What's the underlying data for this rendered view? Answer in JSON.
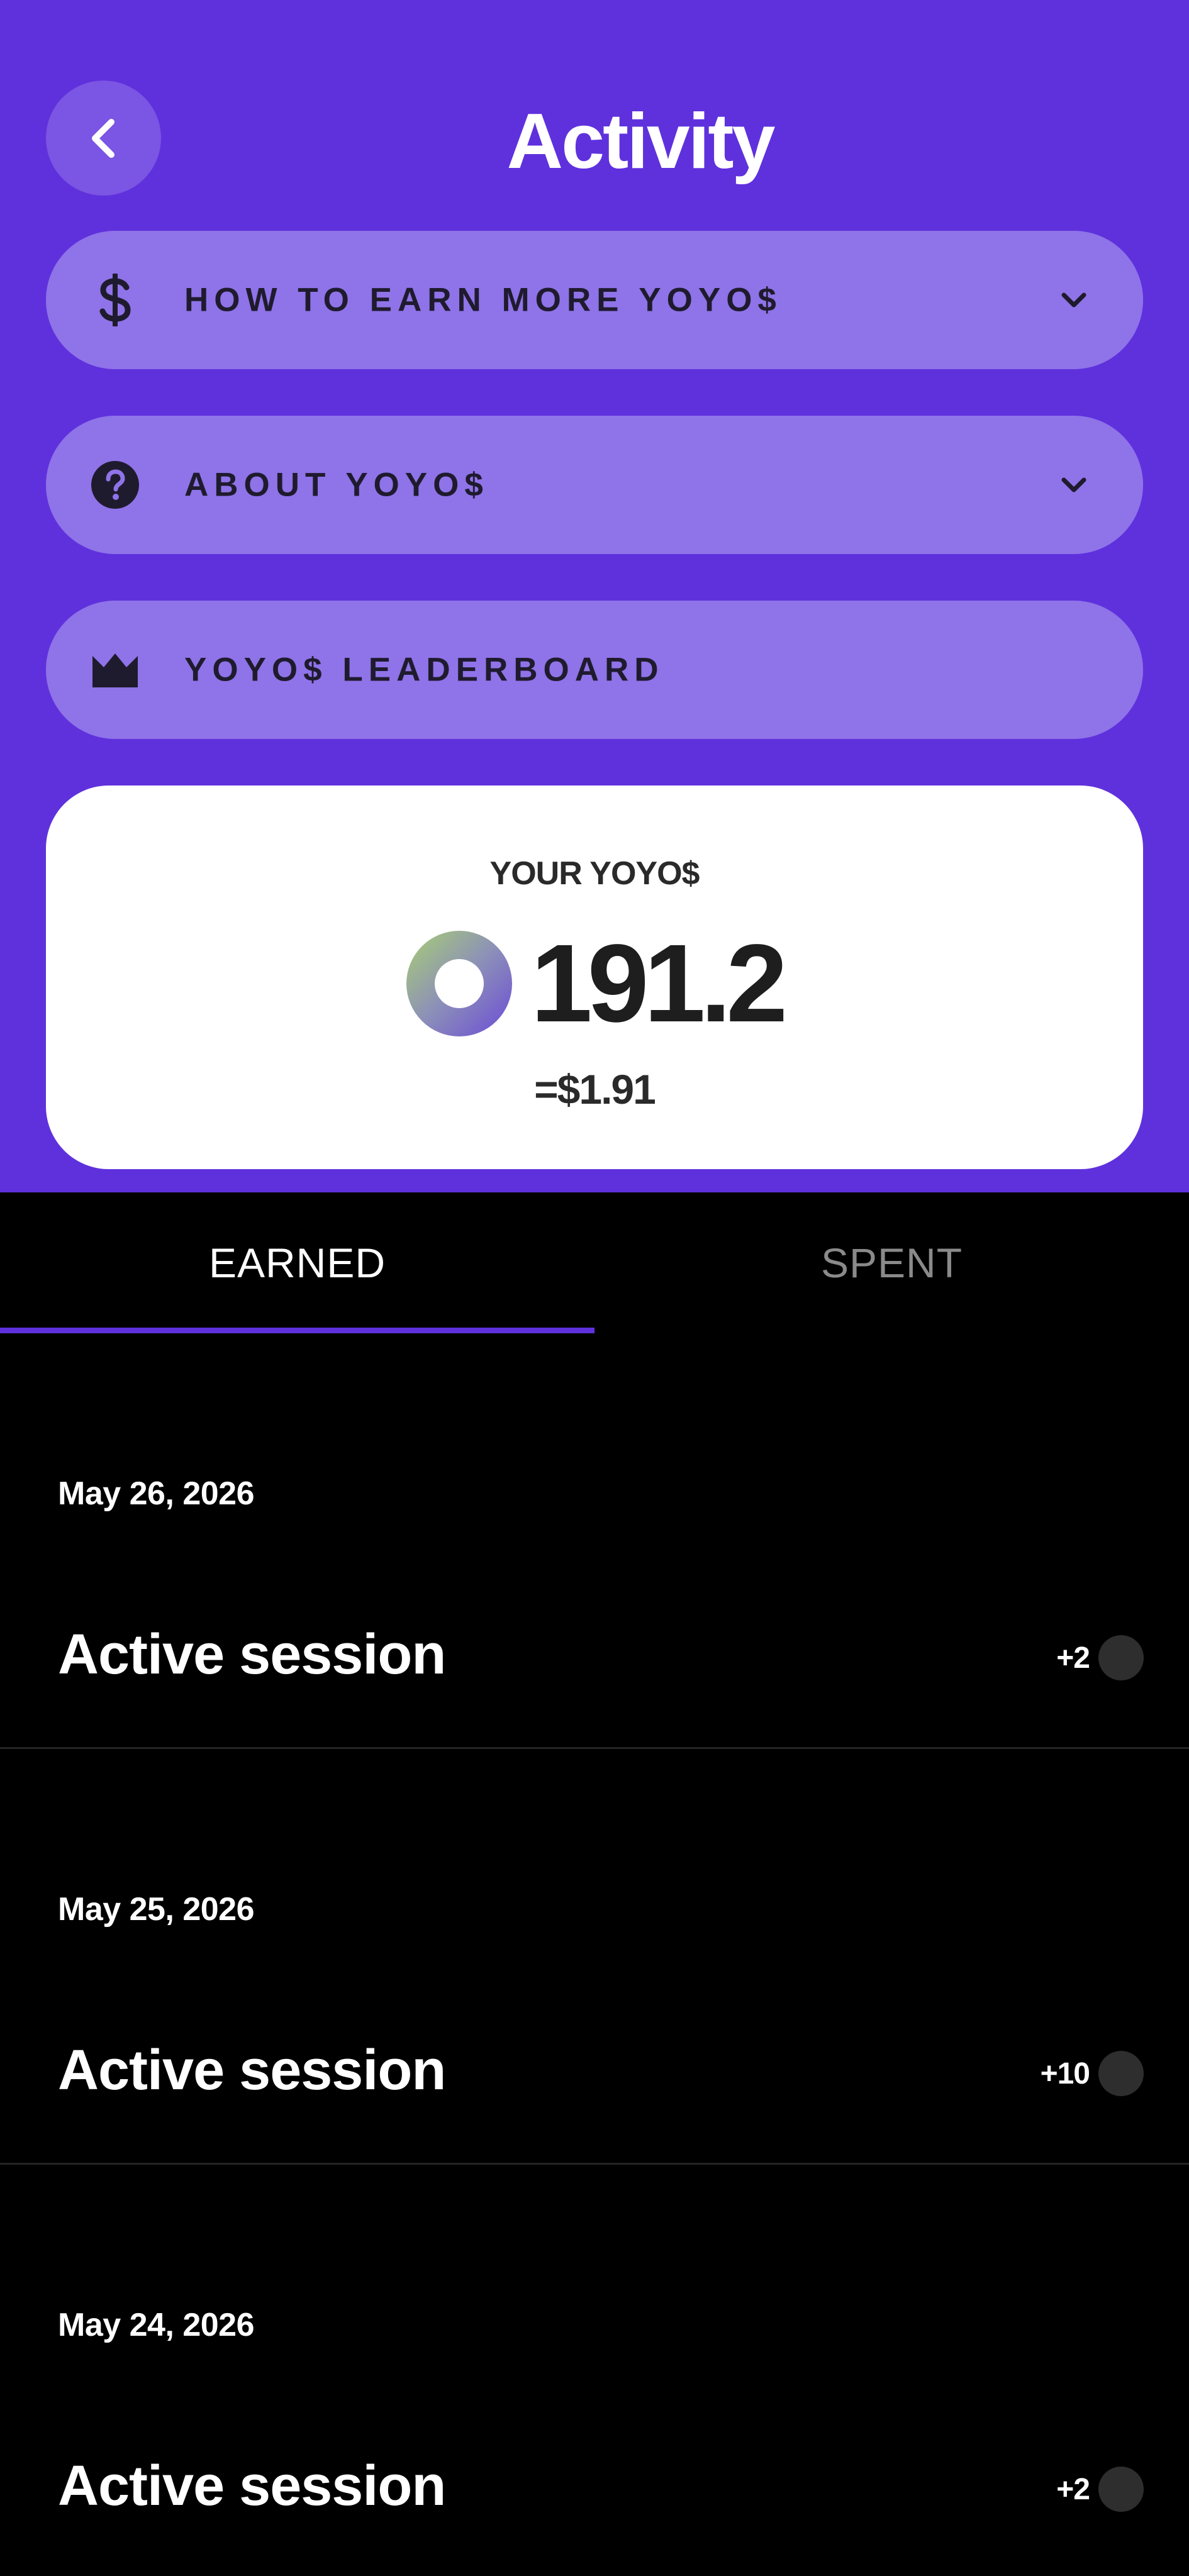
{
  "header": {
    "title": "Activity",
    "back_icon": "chevron-left-icon"
  },
  "menu": [
    {
      "label": "HOW TO EARN MORE YOYO$",
      "icon": "dollar-icon",
      "expandable": true
    },
    {
      "label": "ABOUT YOYO$",
      "icon": "question-circle-icon",
      "expandable": true
    },
    {
      "label": "YOYO$ LEADERBOARD",
      "icon": "crown-icon",
      "expandable": false
    }
  ],
  "balance": {
    "label": "YOUR YOYO$",
    "value": "191.2",
    "usd": "=$1.91",
    "icon": "yoyo-coin-icon"
  },
  "tabs": [
    {
      "label": "EARNED",
      "active": true
    },
    {
      "label": "SPENT",
      "active": false
    }
  ],
  "entries": [
    {
      "date": "May 26, 2026",
      "title": "Active session",
      "amount": "+2"
    },
    {
      "date": "May 25, 2026",
      "title": "Active session",
      "amount": "+10"
    },
    {
      "date": "May 24, 2026",
      "title": "Active session",
      "amount": "+2"
    }
  ],
  "colors": {
    "brand_purple": "#5f31dd",
    "pill_purple": "#8f73e8",
    "background": "#000000"
  }
}
